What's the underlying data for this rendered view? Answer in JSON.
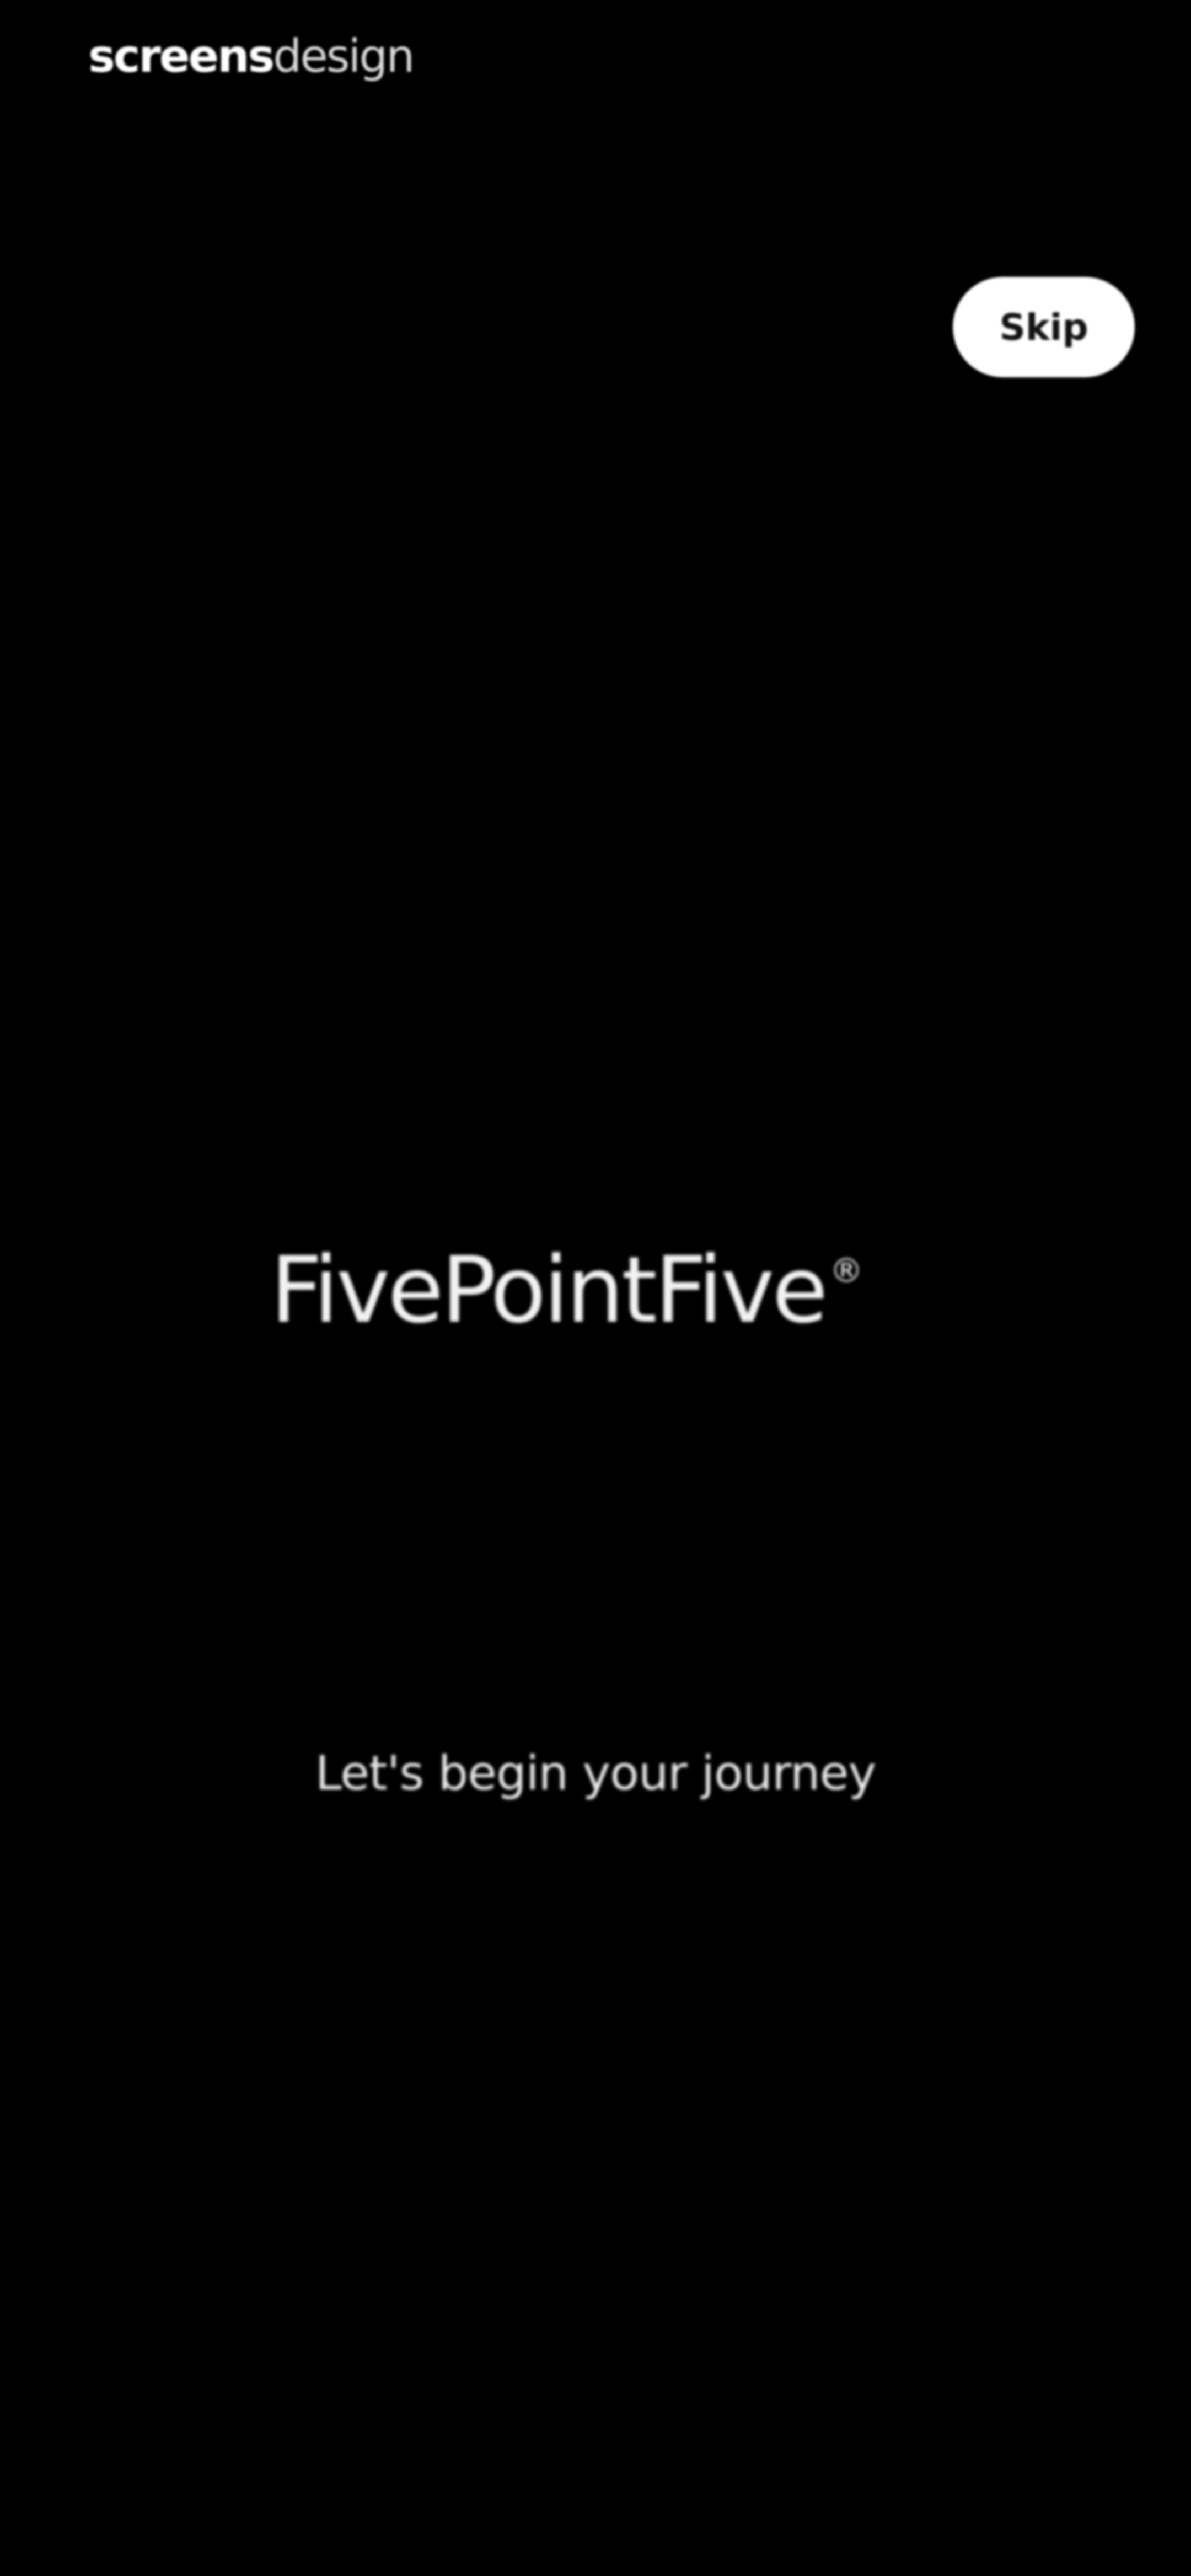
{
  "watermark": {
    "bold_part": "screens",
    "light_part": "design"
  },
  "header": {
    "skip_label": "Skip"
  },
  "brand": {
    "name": "FivePointFive",
    "registered_mark": "®"
  },
  "main": {
    "tagline": "Let's begin your journey"
  },
  "colors": {
    "background": "#000000",
    "text": "#ffffff",
    "skip_button_background": "#ffffff",
    "skip_button_text": "#111111"
  }
}
